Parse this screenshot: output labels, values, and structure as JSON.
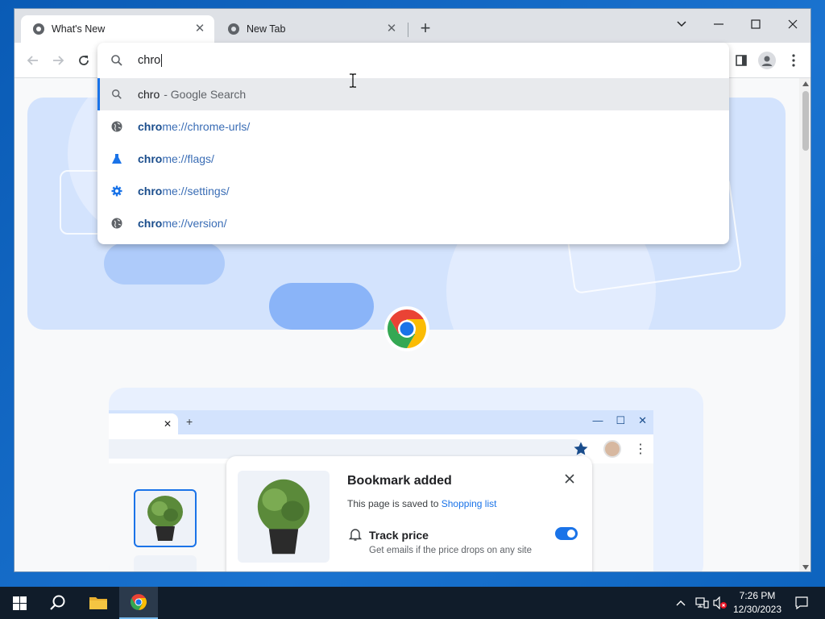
{
  "tabs": [
    {
      "title": "What's New",
      "active": true
    },
    {
      "title": "New Tab",
      "active": false
    }
  ],
  "omnibox": {
    "input_value": "chro",
    "suggestions": [
      {
        "type": "search",
        "bold": "chro",
        "text": "",
        "suffix": "- Google Search",
        "icon": "search-icon"
      },
      {
        "type": "url",
        "bold": "chro",
        "text": "me://chrome-urls/",
        "icon": "globe-icon"
      },
      {
        "type": "url",
        "bold": "chro",
        "text": "me://flags/",
        "icon": "flask-icon"
      },
      {
        "type": "url",
        "bold": "chro",
        "text": "me://settings/",
        "icon": "gear-icon"
      },
      {
        "type": "url",
        "bold": "chro",
        "text": "me://version/",
        "icon": "globe-icon"
      }
    ]
  },
  "promo": {
    "bookmark_title": "Bookmark added",
    "saved_prefix": "This page is saved to",
    "saved_link": "Shopping list",
    "track_title": "Track price",
    "track_sub": "Get emails if the price drops on any site"
  },
  "taskbar": {
    "time": "7:26 PM",
    "date": "12/30/2023"
  },
  "colors": {
    "accent": "#1a73e8",
    "hero_bg": "#d3e3fd",
    "taskbar_bg": "#101c2a"
  }
}
